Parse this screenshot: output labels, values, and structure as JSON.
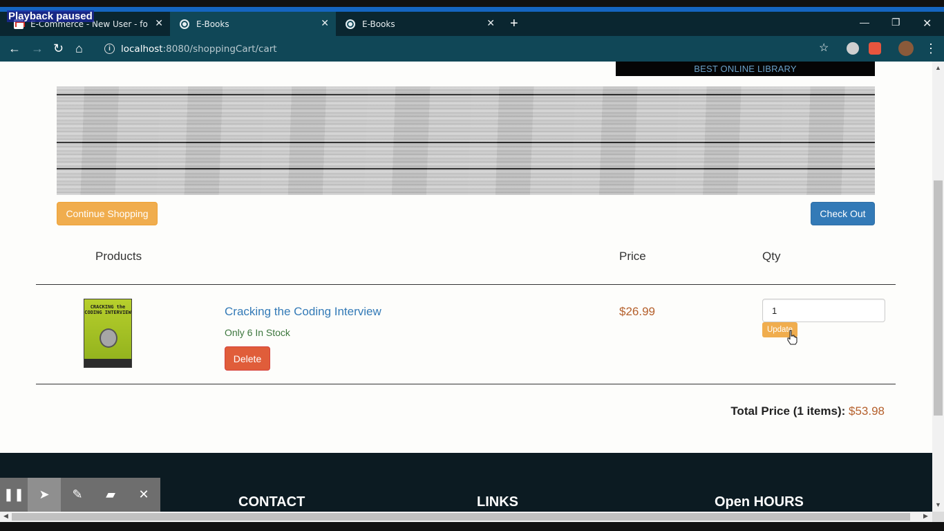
{
  "overlay": {
    "playback_text": "Playback paused"
  },
  "browser": {
    "tabs": [
      {
        "title": "E-Commerce - New User - foysal",
        "favicon": "gmail-icon",
        "active": false
      },
      {
        "title": "E-Books",
        "favicon": "globe-icon",
        "active": true
      },
      {
        "title": "E-Books",
        "favicon": "globe-icon",
        "active": false
      }
    ],
    "url_host": "localhost",
    "url_path": ":8080/shoppingCart/cart"
  },
  "page": {
    "banner_label": "BEST ONLINE LIBRARY",
    "continue_label": "Continue Shopping",
    "checkout_label": "Check Out",
    "headers": {
      "products": "Products",
      "price": "Price",
      "qty": "Qty"
    },
    "cart_item": {
      "name": "Cracking the Coding Interview",
      "cover_title": "CRACKING the CODING INTERVIEW",
      "stock": "Only 6 In Stock",
      "delete_label": "Delete",
      "price": "$26.99",
      "qty": "1",
      "update_label": "Update"
    },
    "total_label": "Total Price (1 items):",
    "total_amount": "$53.98",
    "footer": {
      "contact": "CONTACT",
      "links": "LINKS",
      "hours": "Open HOURS"
    }
  },
  "colors": {
    "accent_orange": "#f0ad4e",
    "primary_blue": "#337ab7",
    "danger": "#e05d3a",
    "price": "#b5602c",
    "footer_bg": "#0c1b22"
  }
}
